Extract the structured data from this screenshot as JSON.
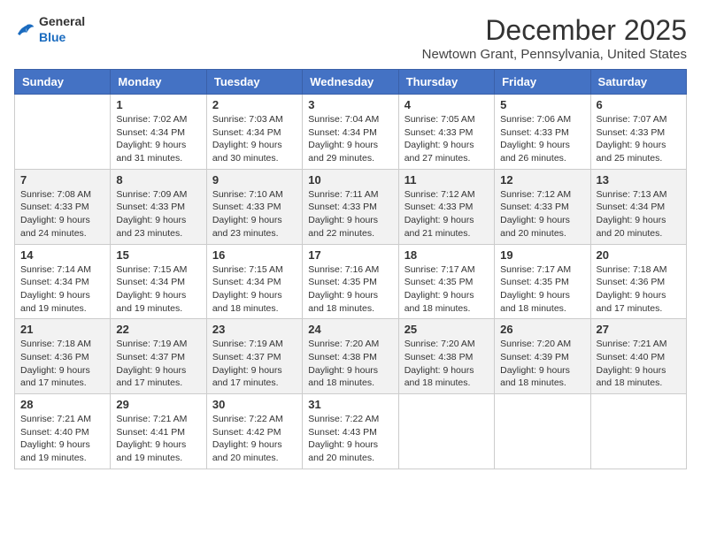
{
  "logo": {
    "general": "General",
    "blue": "Blue"
  },
  "title": "December 2025",
  "location": "Newtown Grant, Pennsylvania, United States",
  "weekdays": [
    "Sunday",
    "Monday",
    "Tuesday",
    "Wednesday",
    "Thursday",
    "Friday",
    "Saturday"
  ],
  "weeks": [
    [
      {
        "day": "",
        "sunrise": "",
        "sunset": "",
        "daylight": ""
      },
      {
        "day": "1",
        "sunrise": "Sunrise: 7:02 AM",
        "sunset": "Sunset: 4:34 PM",
        "daylight": "Daylight: 9 hours and 31 minutes."
      },
      {
        "day": "2",
        "sunrise": "Sunrise: 7:03 AM",
        "sunset": "Sunset: 4:34 PM",
        "daylight": "Daylight: 9 hours and 30 minutes."
      },
      {
        "day": "3",
        "sunrise": "Sunrise: 7:04 AM",
        "sunset": "Sunset: 4:34 PM",
        "daylight": "Daylight: 9 hours and 29 minutes."
      },
      {
        "day": "4",
        "sunrise": "Sunrise: 7:05 AM",
        "sunset": "Sunset: 4:33 PM",
        "daylight": "Daylight: 9 hours and 27 minutes."
      },
      {
        "day": "5",
        "sunrise": "Sunrise: 7:06 AM",
        "sunset": "Sunset: 4:33 PM",
        "daylight": "Daylight: 9 hours and 26 minutes."
      },
      {
        "day": "6",
        "sunrise": "Sunrise: 7:07 AM",
        "sunset": "Sunset: 4:33 PM",
        "daylight": "Daylight: 9 hours and 25 minutes."
      }
    ],
    [
      {
        "day": "7",
        "sunrise": "Sunrise: 7:08 AM",
        "sunset": "Sunset: 4:33 PM",
        "daylight": "Daylight: 9 hours and 24 minutes."
      },
      {
        "day": "8",
        "sunrise": "Sunrise: 7:09 AM",
        "sunset": "Sunset: 4:33 PM",
        "daylight": "Daylight: 9 hours and 23 minutes."
      },
      {
        "day": "9",
        "sunrise": "Sunrise: 7:10 AM",
        "sunset": "Sunset: 4:33 PM",
        "daylight": "Daylight: 9 hours and 23 minutes."
      },
      {
        "day": "10",
        "sunrise": "Sunrise: 7:11 AM",
        "sunset": "Sunset: 4:33 PM",
        "daylight": "Daylight: 9 hours and 22 minutes."
      },
      {
        "day": "11",
        "sunrise": "Sunrise: 7:12 AM",
        "sunset": "Sunset: 4:33 PM",
        "daylight": "Daylight: 9 hours and 21 minutes."
      },
      {
        "day": "12",
        "sunrise": "Sunrise: 7:12 AM",
        "sunset": "Sunset: 4:33 PM",
        "daylight": "Daylight: 9 hours and 20 minutes."
      },
      {
        "day": "13",
        "sunrise": "Sunrise: 7:13 AM",
        "sunset": "Sunset: 4:34 PM",
        "daylight": "Daylight: 9 hours and 20 minutes."
      }
    ],
    [
      {
        "day": "14",
        "sunrise": "Sunrise: 7:14 AM",
        "sunset": "Sunset: 4:34 PM",
        "daylight": "Daylight: 9 hours and 19 minutes."
      },
      {
        "day": "15",
        "sunrise": "Sunrise: 7:15 AM",
        "sunset": "Sunset: 4:34 PM",
        "daylight": "Daylight: 9 hours and 19 minutes."
      },
      {
        "day": "16",
        "sunrise": "Sunrise: 7:15 AM",
        "sunset": "Sunset: 4:34 PM",
        "daylight": "Daylight: 9 hours and 18 minutes."
      },
      {
        "day": "17",
        "sunrise": "Sunrise: 7:16 AM",
        "sunset": "Sunset: 4:35 PM",
        "daylight": "Daylight: 9 hours and 18 minutes."
      },
      {
        "day": "18",
        "sunrise": "Sunrise: 7:17 AM",
        "sunset": "Sunset: 4:35 PM",
        "daylight": "Daylight: 9 hours and 18 minutes."
      },
      {
        "day": "19",
        "sunrise": "Sunrise: 7:17 AM",
        "sunset": "Sunset: 4:35 PM",
        "daylight": "Daylight: 9 hours and 18 minutes."
      },
      {
        "day": "20",
        "sunrise": "Sunrise: 7:18 AM",
        "sunset": "Sunset: 4:36 PM",
        "daylight": "Daylight: 9 hours and 17 minutes."
      }
    ],
    [
      {
        "day": "21",
        "sunrise": "Sunrise: 7:18 AM",
        "sunset": "Sunset: 4:36 PM",
        "daylight": "Daylight: 9 hours and 17 minutes."
      },
      {
        "day": "22",
        "sunrise": "Sunrise: 7:19 AM",
        "sunset": "Sunset: 4:37 PM",
        "daylight": "Daylight: 9 hours and 17 minutes."
      },
      {
        "day": "23",
        "sunrise": "Sunrise: 7:19 AM",
        "sunset": "Sunset: 4:37 PM",
        "daylight": "Daylight: 9 hours and 17 minutes."
      },
      {
        "day": "24",
        "sunrise": "Sunrise: 7:20 AM",
        "sunset": "Sunset: 4:38 PM",
        "daylight": "Daylight: 9 hours and 18 minutes."
      },
      {
        "day": "25",
        "sunrise": "Sunrise: 7:20 AM",
        "sunset": "Sunset: 4:38 PM",
        "daylight": "Daylight: 9 hours and 18 minutes."
      },
      {
        "day": "26",
        "sunrise": "Sunrise: 7:20 AM",
        "sunset": "Sunset: 4:39 PM",
        "daylight": "Daylight: 9 hours and 18 minutes."
      },
      {
        "day": "27",
        "sunrise": "Sunrise: 7:21 AM",
        "sunset": "Sunset: 4:40 PM",
        "daylight": "Daylight: 9 hours and 18 minutes."
      }
    ],
    [
      {
        "day": "28",
        "sunrise": "Sunrise: 7:21 AM",
        "sunset": "Sunset: 4:40 PM",
        "daylight": "Daylight: 9 hours and 19 minutes."
      },
      {
        "day": "29",
        "sunrise": "Sunrise: 7:21 AM",
        "sunset": "Sunset: 4:41 PM",
        "daylight": "Daylight: 9 hours and 19 minutes."
      },
      {
        "day": "30",
        "sunrise": "Sunrise: 7:22 AM",
        "sunset": "Sunset: 4:42 PM",
        "daylight": "Daylight: 9 hours and 20 minutes."
      },
      {
        "day": "31",
        "sunrise": "Sunrise: 7:22 AM",
        "sunset": "Sunset: 4:43 PM",
        "daylight": "Daylight: 9 hours and 20 minutes."
      },
      {
        "day": "",
        "sunrise": "",
        "sunset": "",
        "daylight": ""
      },
      {
        "day": "",
        "sunrise": "",
        "sunset": "",
        "daylight": ""
      },
      {
        "day": "",
        "sunrise": "",
        "sunset": "",
        "daylight": ""
      }
    ]
  ]
}
